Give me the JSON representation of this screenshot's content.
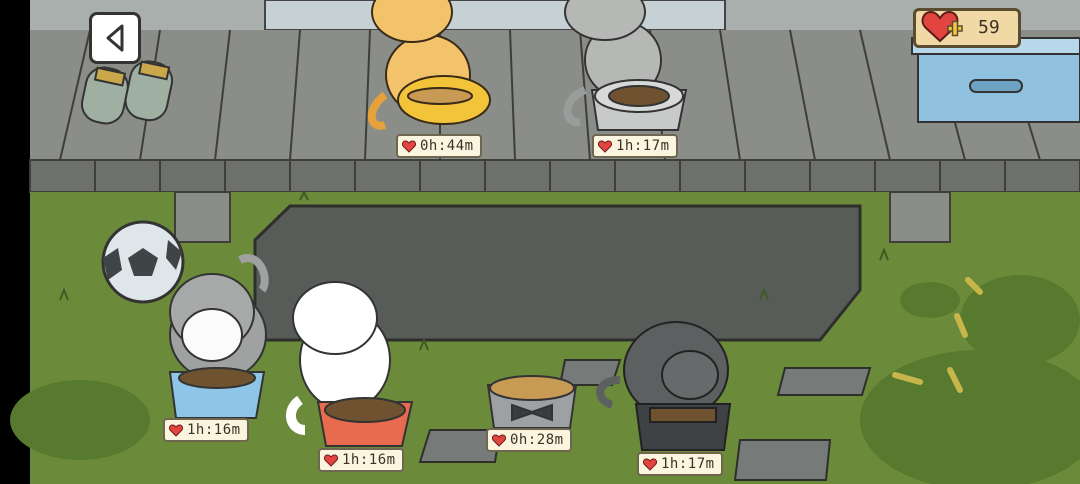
{
  "hud": {
    "back_icon": "back-triangle-icon",
    "heart_icon": "heart-plus-icon",
    "heart_count": "59"
  },
  "timers": [
    {
      "cat": "orange tabby",
      "time": "0h:44m"
    },
    {
      "cat": "gray and white cat",
      "time": "1h:17m"
    },
    {
      "cat": "gray tuxedo cat",
      "time": "1h:16m"
    },
    {
      "cat": "white cat",
      "time": "1h:16m"
    },
    {
      "cat": "bowtie bowl",
      "time": "0h:28m"
    },
    {
      "cat": "dark gray cat",
      "time": "1h:17m"
    }
  ],
  "colors": {
    "grass": "#6a8a3a",
    "deck": "#8d8f8a",
    "heart": "#e2443f",
    "timer_bg": "#fbf5df"
  }
}
